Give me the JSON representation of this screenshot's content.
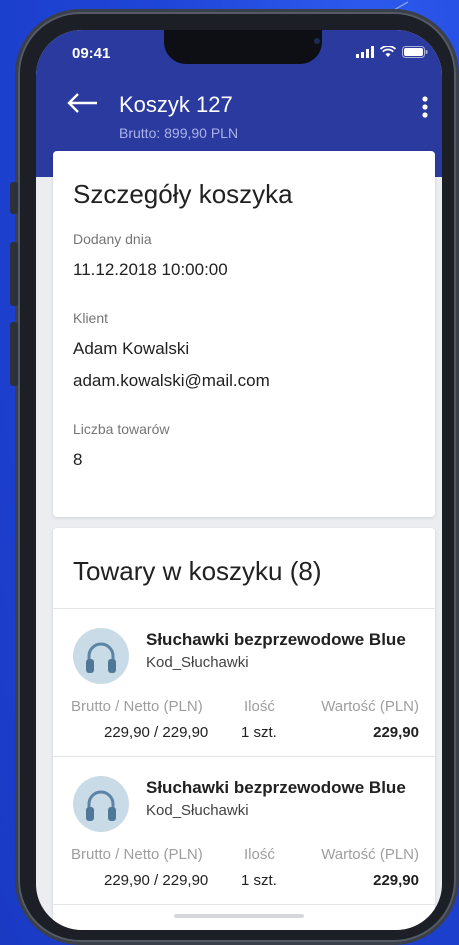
{
  "status_bar": {
    "time": "09:41"
  },
  "appbar": {
    "title": "Koszyk 127",
    "subtitle": "Brutto: 899,90 PLN"
  },
  "details": {
    "title": "Szczegóły koszyka",
    "added_label": "Dodany dnia",
    "added_value": "11.12.2018 10:00:00",
    "client_label": "Klient",
    "client_name": "Adam Kowalski",
    "client_email": "adam.kowalski@mail.com",
    "count_label": "Liczba towarów",
    "count_value": "8"
  },
  "items_section": {
    "title": "Towary w koszyku (8)",
    "items": [
      {
        "name": "Słuchawki bezprzewodowe Blue",
        "code": "Kod_Słuchawki",
        "price_label": "Brutto / Netto (PLN)",
        "price_value": "229,90 / 229,90",
        "qty_label": "Ilość",
        "qty_value": "1 szt.",
        "total_label": "Wartość (PLN)",
        "total_value": "229,90"
      },
      {
        "name": "Słuchawki bezprzewodowe Blue",
        "code": "Kod_Słuchawki",
        "price_label": "Brutto / Netto (PLN)",
        "price_value": "229,90 / 229,90",
        "qty_label": "Ilość",
        "qty_value": "1 szt.",
        "total_label": "Wartość (PLN)",
        "total_value": "229,90"
      }
    ]
  },
  "colors": {
    "header": "#2b3a9f",
    "background": "#1b3fd3",
    "card": "#ffffff"
  },
  "icons": [
    "back-arrow-icon",
    "more-vert-icon",
    "signal-icon",
    "wifi-icon",
    "battery-icon",
    "headphones-icon"
  ]
}
